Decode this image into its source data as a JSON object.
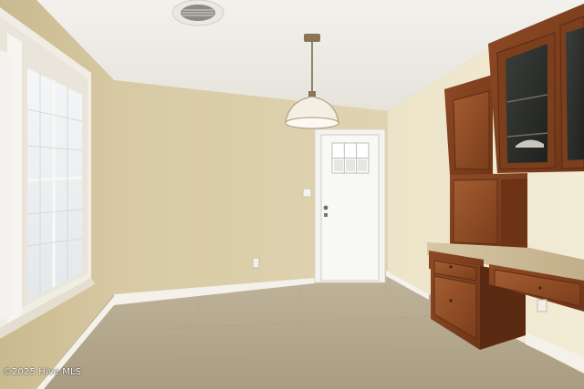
{
  "photo": {
    "watermark": "©2025 Hive MLS"
  }
}
